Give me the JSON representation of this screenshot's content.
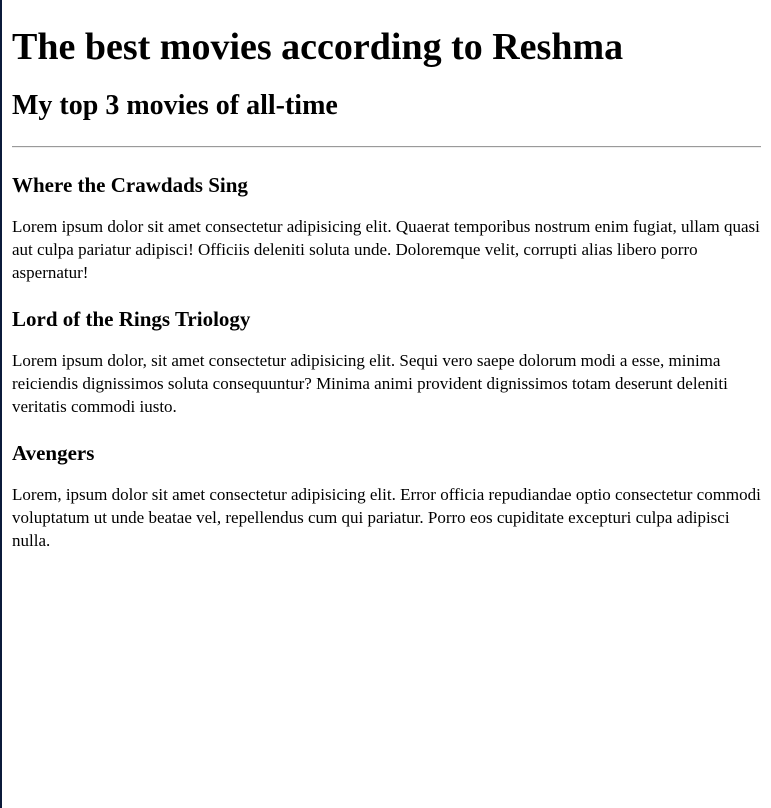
{
  "page": {
    "title": "The best movies according to Reshma",
    "subtitle": "My top 3 movies of all-time"
  },
  "movies": [
    {
      "title": "Where the Crawdads Sing",
      "description": "Lorem ipsum dolor sit amet consectetur adipisicing elit. Quaerat temporibus nostrum enim fugiat, ullam quasi aut culpa pariatur adipisci! Officiis deleniti soluta unde. Doloremque velit, corrupti alias libero porro aspernatur!"
    },
    {
      "title": "Lord of the Rings Triology",
      "description": "Lorem ipsum dolor, sit amet consectetur adipisicing elit. Sequi vero saepe dolorum modi a esse, minima reiciendis dignissimos soluta consequuntur? Minima animi provident dignissimos totam deserunt deleniti veritatis commodi iusto."
    },
    {
      "title": "Avengers",
      "description": "Lorem, ipsum dolor sit amet consectetur adipisicing elit. Error officia repudiandae optio consectetur commodi voluptatum ut unde beatae vel, repellendus cum qui pariatur. Porro eos cupiditate excepturi culpa adipisci nulla."
    }
  ]
}
